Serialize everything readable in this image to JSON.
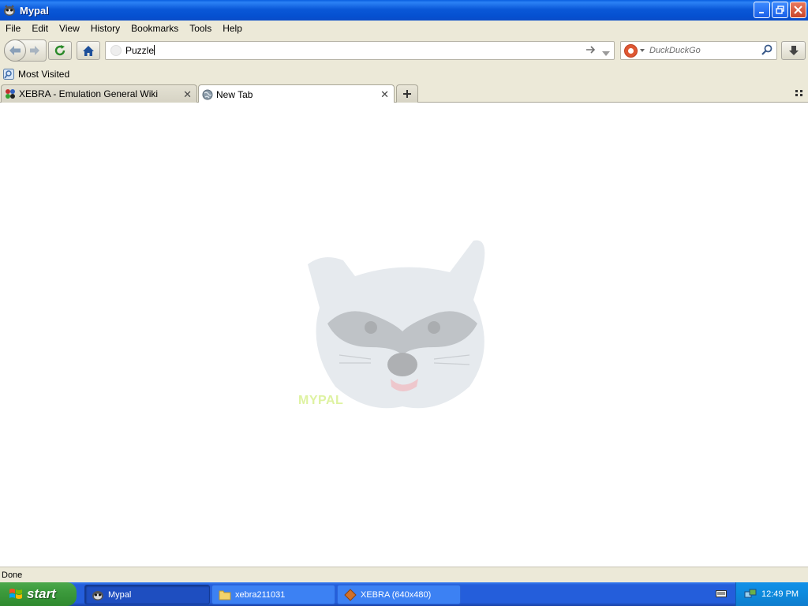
{
  "window": {
    "title": "Mypal",
    "controls": [
      "minimize",
      "maximize",
      "close"
    ]
  },
  "menu": {
    "items": [
      {
        "label": "File",
        "mnemonic": "F"
      },
      {
        "label": "Edit",
        "mnemonic": "E"
      },
      {
        "label": "View",
        "mnemonic": "V"
      },
      {
        "label": "History",
        "mnemonic": "H"
      },
      {
        "label": "Bookmarks",
        "mnemonic": "B"
      },
      {
        "label": "Tools",
        "mnemonic": "T"
      },
      {
        "label": "Help",
        "mnemonic": "H"
      }
    ]
  },
  "toolbar": {
    "url_value": "Puzzle",
    "search_placeholder": "DuckDuckGo",
    "icons": [
      "back-icon",
      "forward-icon",
      "reload-icon",
      "home-icon",
      "go-arrow-icon",
      "url-dropdown-icon",
      "duckduckgo-icon",
      "search-icon",
      "download-icon"
    ]
  },
  "bookmarks": {
    "items": [
      {
        "label": "Most Visited"
      }
    ]
  },
  "tabs": [
    {
      "label": "XEBRA - Emulation General Wiki",
      "active": false
    },
    {
      "label": "New Tab",
      "active": true
    }
  ],
  "statusbar": {
    "text": "Done"
  },
  "taskbar": {
    "start_label": "start",
    "tasks": [
      {
        "label": "Mypal",
        "active": true
      },
      {
        "label": "xebra211031",
        "active": false
      },
      {
        "label": "XEBRA (640x480)",
        "active": false
      }
    ],
    "clock": "12:49 PM"
  },
  "colors": {
    "title_bar": "#0a58d8",
    "chrome": "#ece9d8",
    "taskbar": "#245edb",
    "start_button": "#3c9a3c"
  }
}
